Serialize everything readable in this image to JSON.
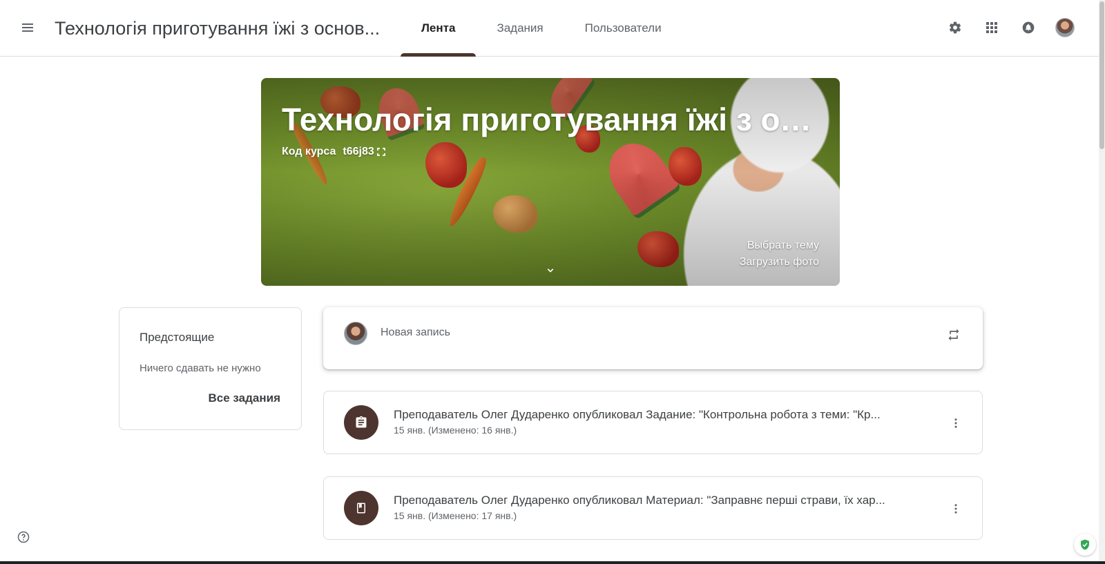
{
  "header": {
    "class_title": "Технологія приготування їжі з основ...",
    "tabs": [
      {
        "label": "Лента",
        "active": true
      },
      {
        "label": "Задания",
        "active": false
      },
      {
        "label": "Пользователи",
        "active": false
      }
    ],
    "icons": [
      "menu-icon",
      "settings-icon",
      "apps-icon",
      "notifications-icon",
      "account-avatar"
    ]
  },
  "banner": {
    "title": "Технологія приготування їжі з осн...",
    "code_label": "Код курса",
    "code_value": "t66j83",
    "select_theme": "Выбрать тему",
    "upload_photo": "Загрузить фото",
    "theme_color": "#4e342e"
  },
  "upcoming": {
    "heading": "Предстоящие",
    "empty_text": "Ничего сдавать не нужно",
    "all_link": "Все задания"
  },
  "composer": {
    "placeholder": "Новая запись"
  },
  "stream": [
    {
      "icon": "assignment-icon",
      "title": "Преподаватель Олег Дударенко опубликовал Задание: \"Контрольна робота з теми: \"Кр...",
      "date": "15 янв. (Изменено: 16 янв.)"
    },
    {
      "icon": "material-icon",
      "title": "Преподаватель Олег Дударенко опубликовал Материал: \"Заправнє перші страви, їх хар...",
      "date": "15 янв. (Изменено: 17 янв.)"
    }
  ]
}
